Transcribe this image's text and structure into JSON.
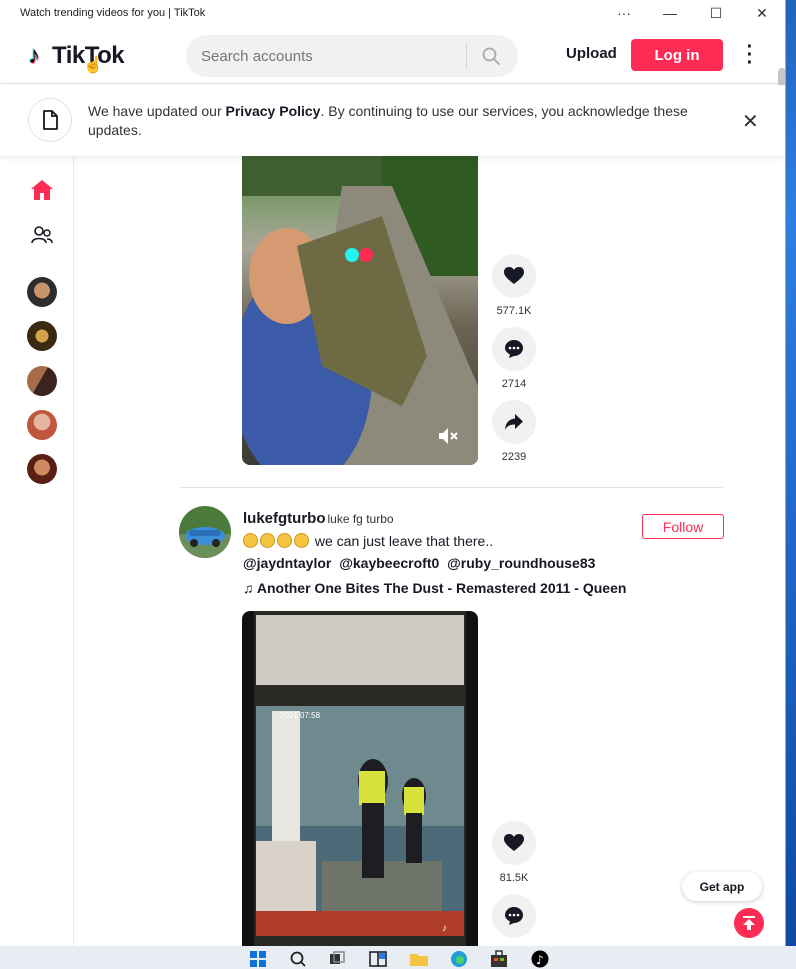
{
  "window": {
    "title": "Watch trending videos for you | TikTok",
    "controls": [
      "more-icon",
      "minimize-icon",
      "maximize-icon",
      "close-icon"
    ]
  },
  "header": {
    "logo_text": "TikTok",
    "search_placeholder": "Search accounts",
    "upload_label": "Upload",
    "login_label": "Log in"
  },
  "banner": {
    "text_before": "We have updated our ",
    "link": "Privacy Policy",
    "text_after": ". By continuing to use our services, you acknowledge these updates."
  },
  "sidebar": {
    "items": [
      {
        "name": "home-icon",
        "color": "#fe2c55"
      },
      {
        "name": "following-icon"
      }
    ],
    "avatars": [
      "avatar-1",
      "avatar-2",
      "avatar-3",
      "avatar-4",
      "avatar-5"
    ]
  },
  "post1": {
    "likes": "577.1K",
    "comments": "2714",
    "shares": "2239"
  },
  "post2": {
    "author": "lukefgturbo",
    "nickname": "luke fg turbo",
    "caption": "we can just leave that there..",
    "mentions": [
      "@jaydntaylor",
      "@kaybeecroft0",
      "@ruby_roundhouse83"
    ],
    "music": "Another One Bites The Dust - Remastered 2011 - Queen",
    "follow_label": "Follow",
    "likes": "81.5K",
    "video_timestamp": "2021 07:58"
  },
  "floating": {
    "get_app": "Get app"
  },
  "colors": {
    "accent": "#fe2c55",
    "text": "#161823",
    "border": "#e3e3e4"
  }
}
